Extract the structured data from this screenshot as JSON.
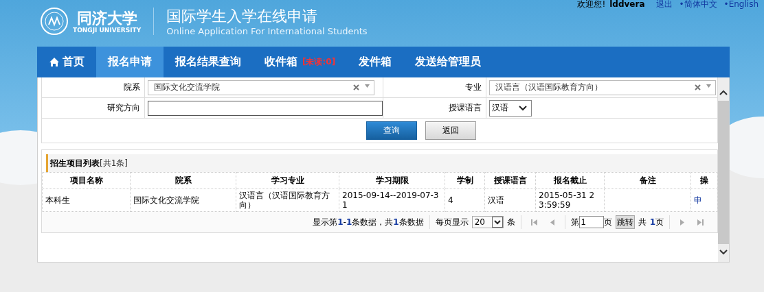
{
  "header": {
    "logo_cn": "同济大学",
    "logo_en": "TONGJI UNIVERSITY",
    "title": "国际学生入学在线申请",
    "subtitle": "Online Application For International Students"
  },
  "user_bar": {
    "greeting": "欢迎您!",
    "username": "lddvera",
    "links": [
      "退出",
      "•简体中文",
      "•English"
    ]
  },
  "nav": [
    {
      "label": "首页",
      "selected": false,
      "kind": "home"
    },
    {
      "label": "报名申请",
      "selected": true,
      "kind": "plain"
    },
    {
      "label": "报名结果查询",
      "selected": false,
      "kind": "plain"
    },
    {
      "label": "收件箱",
      "selected": false,
      "kind": "badge",
      "badge": "[未读:0]"
    },
    {
      "label": "发件箱",
      "selected": false,
      "kind": "plain"
    },
    {
      "label": "发送给管理员",
      "selected": false,
      "kind": "plain"
    }
  ],
  "filters": {
    "department": {
      "label": "院系",
      "value": "国际文化交流学院"
    },
    "major": {
      "label": "专业",
      "value": "汉语言（汉语国际教育方向）"
    },
    "research": {
      "label": "研究方向"
    },
    "language": {
      "label": "授课语言",
      "value": "汉语"
    },
    "buttons": [
      "查询",
      "返回"
    ]
  },
  "table": {
    "title": "招生项目列表",
    "count": "[共1条]",
    "columns": [
      "项目名称",
      "院系",
      "学习专业",
      "学习期限",
      "学制",
      "授课语言",
      "报名截止",
      "备注",
      "操"
    ],
    "rows": [
      [
        "本科生",
        "国际文化交流学院",
        "汉语言（汉语国际教育方向）",
        "2015-09-14--2019-07-31",
        "4",
        "汉语",
        "2015-05-31 23:59:59",
        "",
        "申"
      ]
    ]
  },
  "pager": {
    "summary": "显示第**1**-**1**条数据，共**1**条数据",
    "per_page_label": "每页显示",
    "per_page": "20",
    "per_page_unit": "条",
    "page_prefix": "第",
    "page": "1",
    "page_suffix": "页",
    "jump": "跳转",
    "total_prefix": "共",
    "total": "**1**页"
  }
}
